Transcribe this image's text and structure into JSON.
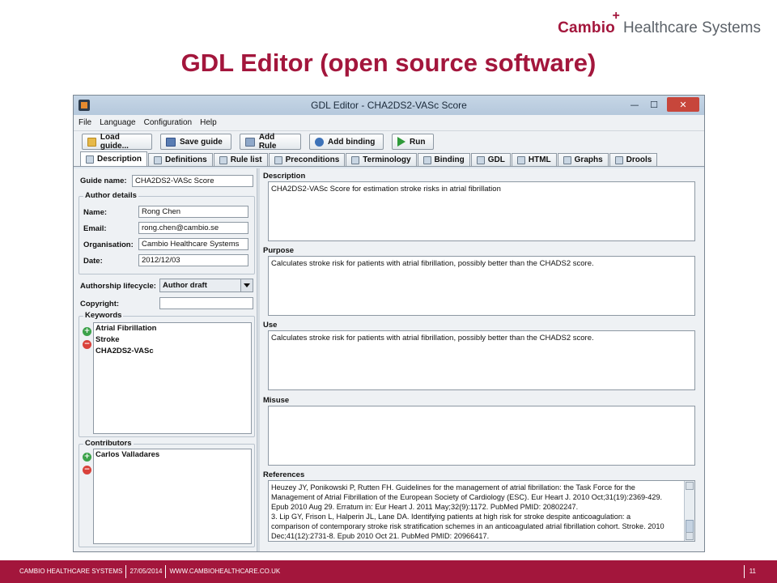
{
  "brand": {
    "name": "Cambio",
    "plus": "+",
    "tagline": "Healthcare Systems"
  },
  "slide_title": "GDL Editor (open source software)",
  "window": {
    "title": "GDL Editor - CHA2DS2-VASc Score",
    "controls": {
      "minimize": "—",
      "maximize": "☐",
      "close": "✕"
    },
    "menu": [
      "File",
      "Language",
      "Configuration",
      "Help"
    ],
    "toolbar": [
      "Load guide...",
      "Save guide",
      "Add Rule",
      "Add binding",
      "Run"
    ],
    "tabs": [
      "Description",
      "Definitions",
      "Rule list",
      "Preconditions",
      "Terminology",
      "Binding",
      "GDL",
      "HTML",
      "Graphs",
      "Drools"
    ],
    "active_tab": "Description"
  },
  "left": {
    "guide_name_label": "Guide name:",
    "guide_name": "CHA2DS2-VASc Score",
    "author_details_title": "Author details",
    "name_label": "Name:",
    "name": "Rong Chen",
    "email_label": "Email:",
    "email": "rong.chen@cambio.se",
    "organisation_label": "Organisation:",
    "organisation": "Cambio Healthcare Systems",
    "date_label": "Date:",
    "date": "2012/12/03",
    "lifecycle_label": "Authorship lifecycle:",
    "lifecycle": "Author draft",
    "copyright_label": "Copyright:",
    "copyright": "",
    "keywords_title": "Keywords",
    "keywords": [
      "Atrial Fibrillation",
      "Stroke",
      "CHA2DS2-VASc"
    ],
    "contributors_title": "Contributors",
    "contributors": [
      "Carlos Valladares"
    ]
  },
  "right": {
    "description_title": "Description",
    "description": "CHA2DS2-VASc Score for estimation stroke risks in atrial fibrillation",
    "purpose_title": "Purpose",
    "purpose": "Calculates stroke risk for patients with atrial fibrillation, possibly better than the CHADS2 score.",
    "use_title": "Use",
    "use": "Calculates stroke risk for patients with atrial fibrillation, possibly better than the CHADS2 score.",
    "misuse_title": "Misuse",
    "misuse": "",
    "references_title": "References",
    "references": [
      "Heuzey JY, Ponikowski P, Rutten FH. Guidelines for the management of atrial fibrillation: the Task Force for the",
      "Management of Atrial Fibrillation of the European Society of Cardiology (ESC). Eur Heart J. 2010 Oct;31(19):2369-429.",
      "Epub 2010 Aug 29. Erratum in: Eur Heart J. 2011 May;32(9):1172. PubMed PMID: 20802247.",
      "3. Lip GY, Frison L, Halperin JL, Lane DA. Identifying patients at high risk for stroke despite anticoagulation: a",
      "comparison of contemporary stroke risk stratification schemes in an anticoagulated atrial fibrillation cohort. Stroke. 2010",
      "Dec;41(12):2731-8. Epub 2010 Oct 21. PubMed PMID: 20966417."
    ]
  },
  "footer": {
    "company": "CAMBIO HEALTHCARE SYSTEMS",
    "date": "27/05/2014",
    "website": "WWW.CAMBIOHEALTHCARE.CO.UK",
    "page": "11"
  },
  "colors": {
    "brand": "#a3163c",
    "tagline": "#5c6269",
    "window_bg": "#eef1f4"
  }
}
